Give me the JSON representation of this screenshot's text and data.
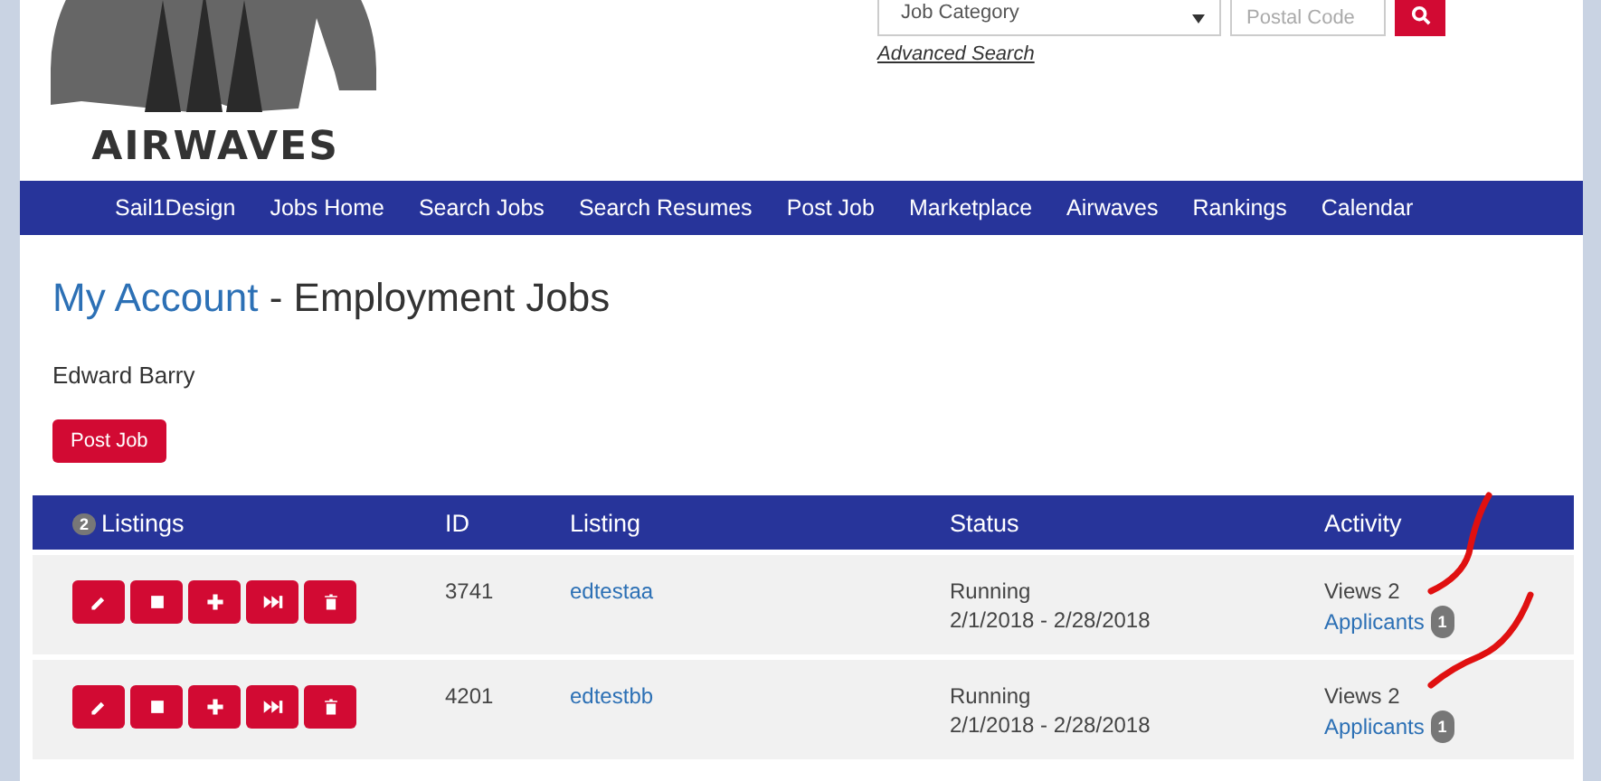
{
  "logo": {
    "text": "AIRWAVES"
  },
  "search": {
    "category_placeholder": "Job Category",
    "postal_placeholder": "Postal Code",
    "advanced_link": "Advanced Search"
  },
  "nav": [
    "Sail1Design",
    "Jobs Home",
    "Search Jobs",
    "Search Resumes",
    "Post Job",
    "Marketplace",
    "Airwaves",
    "Rankings",
    "Calendar"
  ],
  "heading": {
    "link": "My Account",
    "rest": "- Employment Jobs"
  },
  "user_name": "Edward Barry",
  "post_button": "Post Job",
  "table": {
    "count": "2",
    "columns": [
      "Listings",
      "ID",
      "Listing",
      "Status",
      "Activity"
    ],
    "rows": [
      {
        "id": "3741",
        "listing": "edtestaa",
        "status": "Running",
        "dates": "2/1/2018 - 2/28/2018",
        "views": "Views 2",
        "applicants": "Applicants",
        "applicant_count": "1"
      },
      {
        "id": "4201",
        "listing": "edtestbb",
        "status": "Running",
        "dates": "2/1/2018 - 2/28/2018",
        "views": "Views 2",
        "applicants": "Applicants",
        "applicant_count": "1"
      }
    ]
  }
}
